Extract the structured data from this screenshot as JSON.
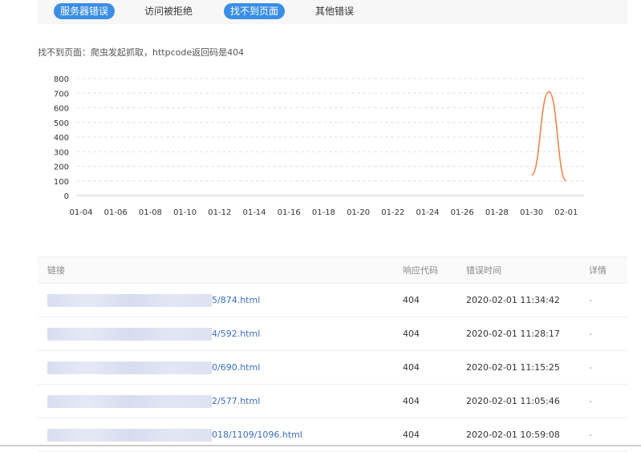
{
  "tabs": [
    {
      "label": "服务器错误",
      "active": true
    },
    {
      "label": "访问被拒绝",
      "active": false
    },
    {
      "label": "找不到页面",
      "active": true
    },
    {
      "label": "其他错误",
      "active": false
    }
  ],
  "description": "找不到页面：爬虫发起抓取，httpcode返回码是404",
  "chart_data": {
    "type": "line",
    "x": [
      "01-30",
      "01-31",
      "02-01"
    ],
    "series": [
      {
        "values": [
          140,
          710,
          100
        ],
        "color": "#f0844b"
      }
    ],
    "x_tick_labels": [
      "01-04",
      "01-06",
      "01-08",
      "01-10",
      "01-12",
      "01-14",
      "01-16",
      "01-18",
      "01-20",
      "01-22",
      "01-24",
      "01-26",
      "01-28",
      "01-30",
      "02-01"
    ],
    "y_tick_labels": [
      "0",
      "100",
      "200",
      "300",
      "400",
      "500",
      "600",
      "700",
      "800"
    ],
    "ylim": [
      0,
      800
    ],
    "grid": true
  },
  "table": {
    "headers": {
      "link": "链接",
      "code": "响应代码",
      "time": "错误时间",
      "detail": "详情"
    },
    "rows": [
      {
        "link_suffix": "5/874.html",
        "code": "404",
        "time": "2020-02-01 11:34:42",
        "detail": "-"
      },
      {
        "link_suffix": "4/592.html",
        "code": "404",
        "time": "2020-02-01 11:28:17",
        "detail": "-"
      },
      {
        "link_suffix": "0/690.html",
        "code": "404",
        "time": "2020-02-01 11:15:25",
        "detail": "-"
      },
      {
        "link_suffix": "2/577.html",
        "code": "404",
        "time": "2020-02-01 11:05:46",
        "detail": "-"
      },
      {
        "link_suffix": "018/1109/1096.html",
        "code": "404",
        "time": "2020-02-01 10:59:08",
        "detail": "-"
      }
    ]
  },
  "colors": {
    "accent": "#3a8ee6",
    "line": "#f0844b",
    "link": "#3a6ec6"
  }
}
